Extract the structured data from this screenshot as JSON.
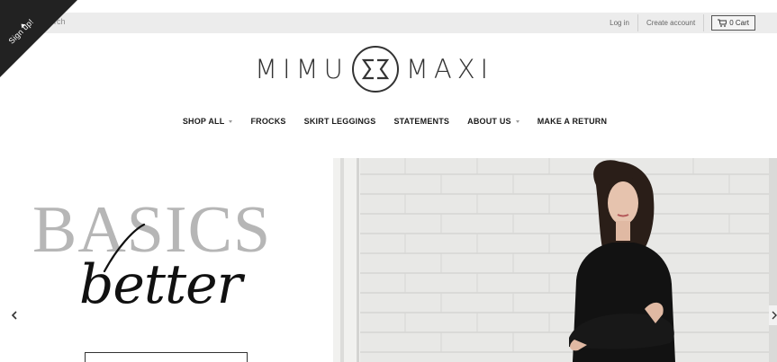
{
  "signup": {
    "label": "Sign up!"
  },
  "header": {
    "search_text": "rch",
    "login_label": "Log in",
    "create_account_label": "Create account",
    "cart_label": "0 Cart"
  },
  "logo": {
    "left_word": "MIMU",
    "right_word": "MAXI"
  },
  "nav": {
    "items": [
      {
        "label": "SHOP ALL",
        "dropdown": true
      },
      {
        "label": "FROCKS",
        "dropdown": false
      },
      {
        "label": "SKIRT LEGGINGS",
        "dropdown": false
      },
      {
        "label": "STATEMENTS",
        "dropdown": false
      },
      {
        "label": "ABOUT US",
        "dropdown": true
      },
      {
        "label": "MAKE A RETURN",
        "dropdown": false
      }
    ]
  },
  "hero": {
    "headline": "BASICS",
    "subheadline": "better",
    "prev_icon": "chevron-left-icon",
    "next_icon": "chevron-right-icon"
  },
  "colors": {
    "topbar": "#ececec",
    "ribbon": "#222222",
    "headline_gray": "#b6b6b6",
    "brick": "#e9e9e7"
  }
}
